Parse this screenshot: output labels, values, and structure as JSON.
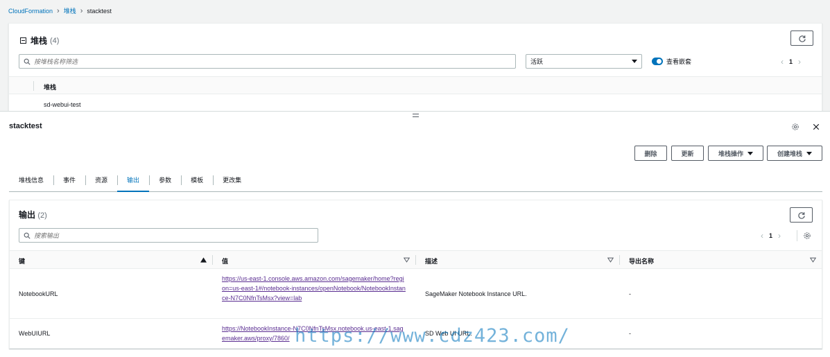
{
  "breadcrumb": {
    "items": [
      "CloudFormation",
      "堆栈",
      "stacktest"
    ]
  },
  "stacks_panel": {
    "title": "堆栈",
    "count": "(4)",
    "search_placeholder": "按堆栈名称筛选",
    "filter_value": "活跃",
    "toggle_label": "查看嵌套",
    "page": "1",
    "column_header": "堆栈",
    "rows": [
      "sd-webui-test"
    ]
  },
  "detail": {
    "title": "stacktest",
    "actions": {
      "delete": "删除",
      "update": "更新",
      "stack_actions": "堆栈操作",
      "create_stack": "创建堆栈"
    },
    "tabs": [
      "堆栈信息",
      "事件",
      "资源",
      "输出",
      "参数",
      "模板",
      "更改集"
    ],
    "active_tab": "输出"
  },
  "outputs": {
    "title": "输出",
    "count": "(2)",
    "search_placeholder": "搜索输出",
    "page": "1",
    "columns": {
      "key": "键",
      "value": "值",
      "description": "描述",
      "export_name": "导出名称"
    },
    "rows": [
      {
        "key": "NotebookURL",
        "value": "https://us-east-1.console.aws.amazon.com/sagemaker/home?region=us-east-1#/notebook-instances/openNotebook/NotebookInstance-N7C0NfnTsMsx?view=lab",
        "description": "SageMaker Notebook Instance URL.",
        "export_name": "-"
      },
      {
        "key": "WebUIURL",
        "value": "https://NotebookInstance-N7C0NfnTsMsx.notebook.us-east-1.sagemaker.aws/proxy/7860/",
        "description": "SD Web UI URL.",
        "export_name": "-"
      }
    ]
  },
  "watermark": "https://www.cdz423.com/",
  "colors": {
    "link": "#0073bb",
    "visited_link": "#5a2d91",
    "border": "#aab7b8",
    "background": "#f2f3f3"
  }
}
